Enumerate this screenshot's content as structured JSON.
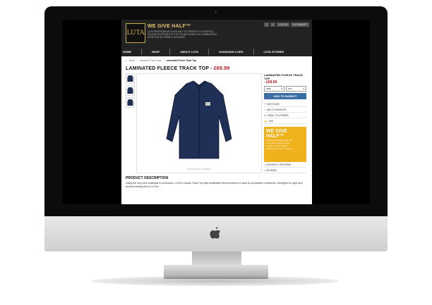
{
  "site": {
    "tagline": "WE GIVE HALF™",
    "blurb": "LUTA SPORTSWEAR GIVES HALF ITS PROFITS TO SPORTS & EDUCATION PROJECTS FOR YOUNG PEOPLE IN COMMUNITIES AFFECTED BY CRIME & VIOLENCE",
    "logo_text": "LUTA",
    "utility": [
      "f",
      "t",
      "LOG IN",
      "MY BASKET"
    ],
    "nav": [
      "HOME",
      "SHOP",
      "ABOUT LUTA",
      "CHANGING LIVES",
      "LUTA STORIES"
    ]
  },
  "breadcrumb": [
    "Shop",
    "Hoodies & Track Tops",
    "Laminated Fleece Track Top"
  ],
  "product": {
    "title": "LAMINATED FLEECE TRACK TOP - ",
    "price": "£69.99",
    "side_title": "LAMINATED FLEECE TRACK TOP",
    "side_price": "- £69.99",
    "size_label": "SIZE",
    "qty_label": "QTY",
    "add_label": "ADD TO BASKET",
    "links": [
      "SIZE GUIDE",
      "ADD TO WISHLIST",
      "EMAIL TO A FRIEND",
      "LIKE"
    ],
    "image_caption": "Product Shown | Midnight",
    "promo_big": "WE GIVE HALF™",
    "promo_small": "LUTA Sportswear gives half its profit to support young people in communities affected by crime & violence",
    "info_links": [
      "DELIVERY & RETURNS",
      "REVIEWS"
    ]
  },
  "description": {
    "heading": "PRODUCT DESCRIPTION",
    "text": "Using the very best materials in production, LUTA's classic Track Top with breathable fleeced interior is ideal for all-weather conditions. Designed for style and serious training this is LUTA's"
  },
  "colors": {
    "accent": "#b5121b",
    "button": "#3a6ea5",
    "promo": "#f0b21a",
    "jacket": "#1f2f55"
  }
}
